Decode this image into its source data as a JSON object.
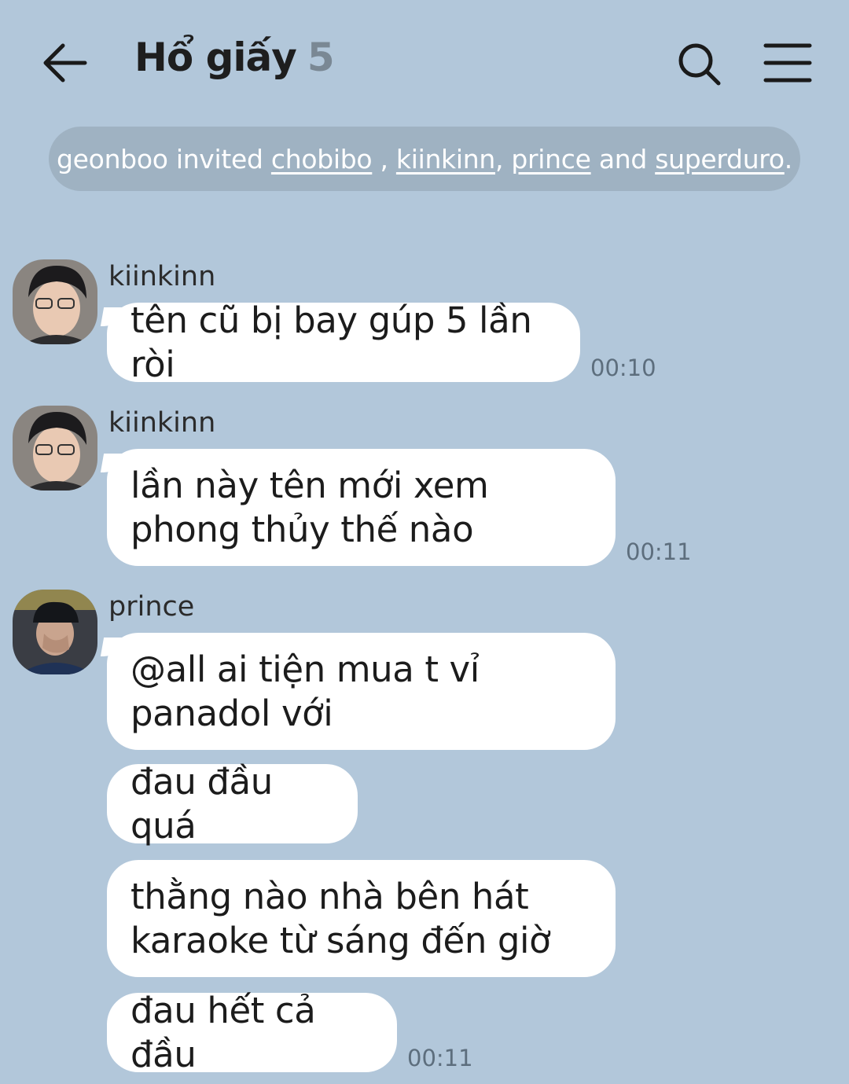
{
  "header": {
    "title": "Hổ giấy",
    "member_count": "5"
  },
  "notice": {
    "inviter": "geonboo",
    "invited_word": "invited",
    "names": [
      "chobibo",
      "kiinkinn",
      "prince",
      "superduro"
    ],
    "and_word": "and"
  },
  "messages": [
    {
      "sender": "kiinkinn",
      "text": "tên cũ bị bay gúp 5 lần ròi",
      "time": "00:10"
    },
    {
      "sender": "kiinkinn",
      "text": "lần này tên mới xem phong thủy thế nào",
      "time": "00:11"
    },
    {
      "sender": "prince",
      "texts": [
        "@all ai tiện mua t vỉ panadol với",
        "đau đầu quá",
        "thằng nào nhà bên hát karaoke từ sáng đến giờ",
        "đau hết cả đầu"
      ],
      "time": "00:11"
    }
  ],
  "colors": {
    "background": "#b2c7da",
    "notice_bg": "#9fb2c2",
    "bubble": "#ffffff",
    "timestamp": "#5d6e7d"
  },
  "icons": {
    "back": "arrow-left-icon",
    "search": "search-icon",
    "menu": "hamburger-menu-icon"
  }
}
